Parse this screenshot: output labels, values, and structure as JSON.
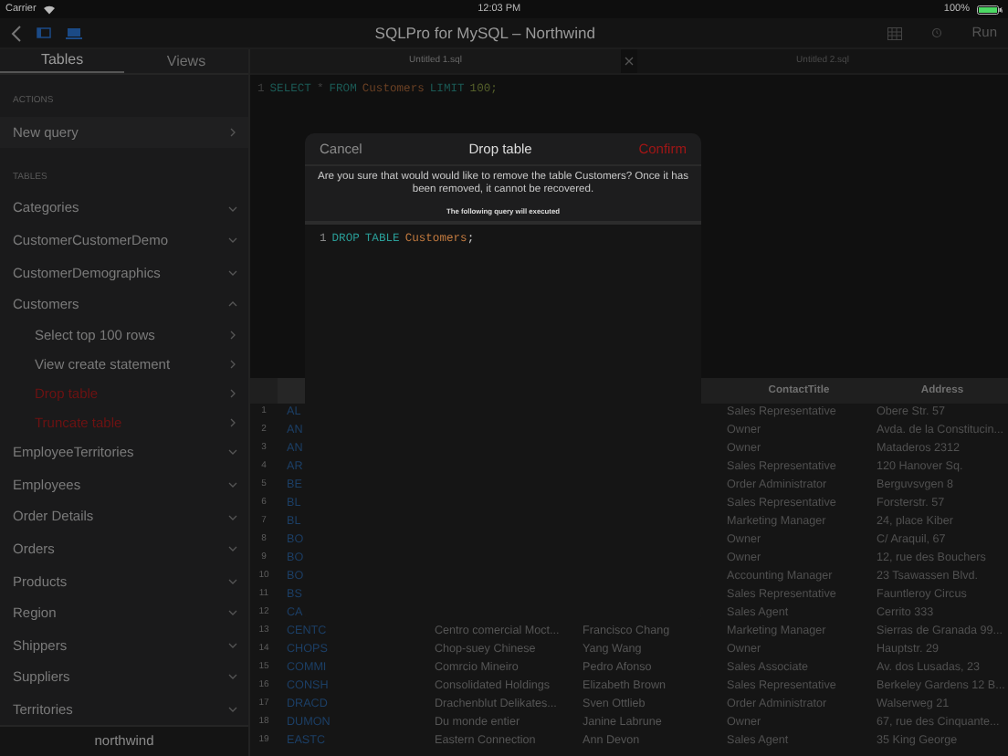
{
  "status_bar": {
    "carrier": "Carrier",
    "time": "12:03 PM",
    "battery": "100%"
  },
  "toolbar": {
    "title": "SQLPro for MySQL – Northwind",
    "run": "Run"
  },
  "sidebar": {
    "tabs": [
      {
        "label": "Tables",
        "selected": true
      },
      {
        "label": "Views",
        "selected": false
      }
    ],
    "sections": [
      {
        "heading": "ACTIONS",
        "items": [
          {
            "label": "New query",
            "kind": "action"
          }
        ]
      },
      {
        "heading": "TABLES",
        "items": [
          {
            "label": "Categories",
            "kind": "table",
            "expanded": false
          },
          {
            "label": "CustomerCustomerDemo",
            "kind": "table",
            "expanded": false
          },
          {
            "label": "CustomerDemographics",
            "kind": "table",
            "expanded": false
          },
          {
            "label": "Customers",
            "kind": "table",
            "expanded": true,
            "children": [
              {
                "label": "Select top 100 rows",
                "destructive": false
              },
              {
                "label": "View create statement",
                "destructive": false
              },
              {
                "label": "Drop table",
                "destructive": true
              },
              {
                "label": "Truncate table",
                "destructive": true
              }
            ]
          },
          {
            "label": "EmployeeTerritories",
            "kind": "table",
            "expanded": false
          },
          {
            "label": "Employees",
            "kind": "table",
            "expanded": false
          },
          {
            "label": "Order Details",
            "kind": "table",
            "expanded": false
          },
          {
            "label": "Orders",
            "kind": "table",
            "expanded": false
          },
          {
            "label": "Products",
            "kind": "table",
            "expanded": false
          },
          {
            "label": "Region",
            "kind": "table",
            "expanded": false
          },
          {
            "label": "Shippers",
            "kind": "table",
            "expanded": false
          },
          {
            "label": "Suppliers",
            "kind": "table",
            "expanded": false
          },
          {
            "label": "Territories",
            "kind": "table",
            "expanded": false
          }
        ]
      }
    ],
    "footer": "northwind"
  },
  "editor": {
    "tabs": [
      {
        "label": "Untitled 1.sql",
        "selected": true
      },
      {
        "label": "Untitled 2.sql",
        "selected": false
      }
    ],
    "lines": [
      {
        "number": "1",
        "tokens": [
          {
            "text": "SELECT",
            "kind": "keyword"
          },
          {
            "text": "*",
            "kind": "plain"
          },
          {
            "text": "FROM",
            "kind": "keyword"
          },
          {
            "text": "Customers",
            "kind": "identifier"
          },
          {
            "text": "LIMIT",
            "kind": "keyword"
          },
          {
            "text": "100;",
            "kind": "number"
          }
        ]
      }
    ]
  },
  "results": {
    "columns": [
      "ContactTitle",
      "Address"
    ],
    "rows": [
      {
        "number": "1",
        "id": "AL",
        "title": "Sales Representative",
        "address": "Obere Str. 57"
      },
      {
        "number": "2",
        "id": "AN",
        "title": "Owner",
        "address": "Avda. de la Constitucin..."
      },
      {
        "number": "3",
        "id": "AN",
        "title": "Owner",
        "address": "Mataderos  2312"
      },
      {
        "number": "4",
        "id": "AR",
        "title": "Sales Representative",
        "address": "120 Hanover Sq."
      },
      {
        "number": "5",
        "id": "BE",
        "title": "Order Administrator",
        "address": "Berguvsvgen  8"
      },
      {
        "number": "6",
        "id": "BL",
        "title": "Sales Representative",
        "address": "Forsterstr. 57"
      },
      {
        "number": "7",
        "id": "BL",
        "title": "Marketing Manager",
        "address": "24, place Kiber"
      },
      {
        "number": "8",
        "id": "BO",
        "title": "Owner",
        "address": "C/ Araquil, 67"
      },
      {
        "number": "9",
        "id": "BO",
        "title": "Owner",
        "address": "12, rue des Bouchers"
      },
      {
        "number": "10",
        "id": "BO",
        "title": "Accounting Manager",
        "address": "23 Tsawassen Blvd."
      },
      {
        "number": "11",
        "id": "BS",
        "title": "Sales Representative",
        "address": "Fauntleroy Circus"
      },
      {
        "number": "12",
        "id": "CA",
        "title": "Sales Agent",
        "address": "Cerrito 333"
      },
      {
        "number": "13",
        "id": "CENTC",
        "company": "Centro comercial Moct...",
        "contact": "Francisco Chang",
        "title": "Marketing Manager",
        "address": "Sierras de Granada 99..."
      },
      {
        "number": "14",
        "id": "CHOPS",
        "company": "Chop-suey Chinese",
        "contact": "Yang Wang",
        "title": "Owner",
        "address": "Hauptstr. 29"
      },
      {
        "number": "15",
        "id": "COMMI",
        "company": "Comrcio Mineiro",
        "contact": "Pedro Afonso",
        "title": "Sales Associate",
        "address": "Av. dos Lusadas, 23"
      },
      {
        "number": "16",
        "id": "CONSH",
        "company": "Consolidated Holdings",
        "contact": "Elizabeth Brown",
        "title": "Sales Representative",
        "address": "Berkeley Gardens 12  B..."
      },
      {
        "number": "17",
        "id": "DRACD",
        "company": "Drachenblut Delikates...",
        "contact": "Sven Ottlieb",
        "title": "Order Administrator",
        "address": "Walserweg 21"
      },
      {
        "number": "18",
        "id": "DUMON",
        "company": "Du monde entier",
        "contact": "Janine Labrune",
        "title": "Owner",
        "address": "67, rue des Cinquante..."
      },
      {
        "number": "19",
        "id": "EASTC",
        "company": "Eastern Connection",
        "contact": "Ann Devon",
        "title": "Sales Agent",
        "address": "35 King George"
      }
    ]
  },
  "dialog": {
    "cancel": "Cancel",
    "title": "Drop table",
    "confirm": "Confirm",
    "message": "Are you sure that would would like to remove the table Customers? Once it has been removed, it cannot be recovered.",
    "note": "The following query will executed",
    "lines": [
      {
        "number": "1",
        "tokens": [
          {
            "text": "DROP",
            "kind": "keyword"
          },
          {
            "text": "TABLE",
            "kind": "keyword"
          },
          {
            "text": "Customers",
            "kind": "identifier"
          },
          {
            "text": ";",
            "kind": "punctuation"
          }
        ]
      }
    ]
  }
}
